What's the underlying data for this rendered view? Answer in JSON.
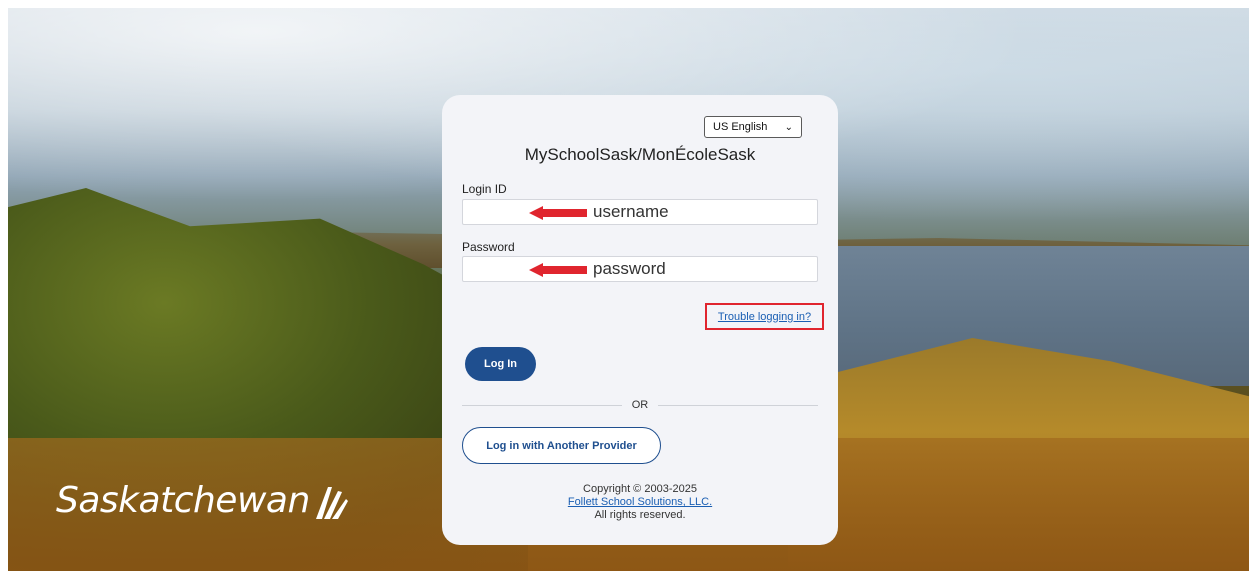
{
  "page": {
    "brand_name": "Saskatchewan",
    "language_select": {
      "selected": "US English"
    },
    "app_title": "MySchoolSask/MonÉcoleSask"
  },
  "form": {
    "login_id_label": "Login ID",
    "login_id_hint": "username",
    "password_label": "Password",
    "password_hint": "password",
    "trouble_link": "Trouble logging in?",
    "login_button": "Log In",
    "or_divider": "OR",
    "provider_button": "Log in with Another Provider"
  },
  "footer": {
    "copyright": "Copyright © 2003-2025",
    "company_link": "Follett School Solutions, LLC.",
    "rights": "All rights reserved."
  },
  "colors": {
    "primary": "#1f4f8f",
    "link": "#1b5fb3",
    "highlight": "#e0252e",
    "arrow": "#e0252e"
  }
}
